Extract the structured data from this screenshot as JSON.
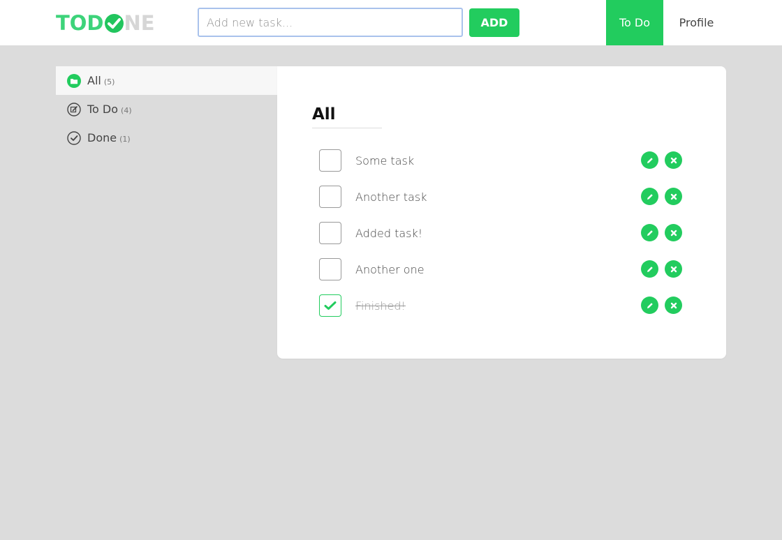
{
  "brand": {
    "logo_before": "TOD",
    "logo_after": "NE",
    "accent": "#22cc5e"
  },
  "header": {
    "search": {
      "placeholder": "Add new task...",
      "value": ""
    },
    "add_label": "ADD",
    "nav": [
      {
        "label": "To Do",
        "active": true
      },
      {
        "label": "Profile",
        "active": false
      }
    ]
  },
  "sidebar": {
    "items": [
      {
        "label": "All",
        "count": "(5)",
        "icon": "folder-icon",
        "active": true
      },
      {
        "label": "To Do",
        "count": "(4)",
        "icon": "edit-icon",
        "active": false
      },
      {
        "label": "Done",
        "count": "(1)",
        "icon": "check-circle-icon",
        "active": false
      }
    ]
  },
  "main": {
    "title": "All",
    "tasks": [
      {
        "label": "Some task",
        "done": false
      },
      {
        "label": "Another task",
        "done": false
      },
      {
        "label": "Added task!",
        "done": false
      },
      {
        "label": "Another one",
        "done": false
      },
      {
        "label": "Finished!",
        "done": true
      }
    ]
  }
}
